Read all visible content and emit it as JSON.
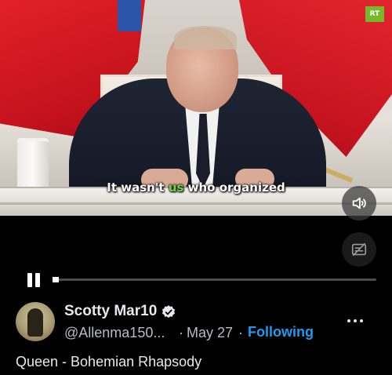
{
  "video": {
    "caption_before": "It wasn't ",
    "caption_highlight": "us",
    "caption_after": " who organized",
    "channel_logo": "RT",
    "progress_fraction": 0.02
  },
  "controls": {
    "volume_icon": "speaker-icon",
    "captions_icon": "captions-off-icon",
    "play_state_icon": "pause-icon"
  },
  "post": {
    "author_name": "Scotty Mar10",
    "handle": "@Allenma150...",
    "separator": "·",
    "date": "May 27",
    "follow_status": "Following",
    "text": "Queen - Bohemian Rhapsody",
    "more_icon": "more-options-icon"
  },
  "colors": {
    "background": "#000000",
    "link_blue": "#1d9bf0",
    "caption_highlight": "#7bd04a"
  }
}
